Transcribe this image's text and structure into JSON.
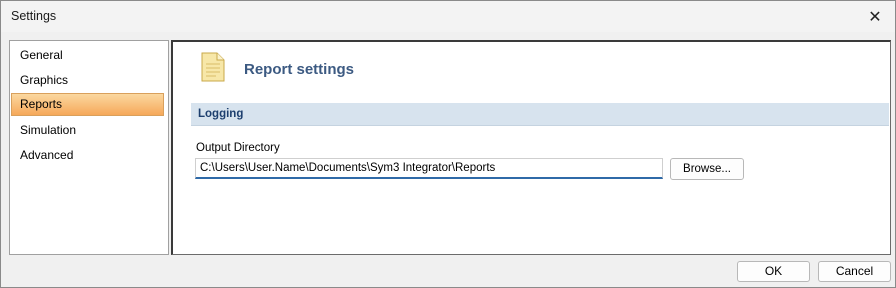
{
  "window": {
    "title": "Settings",
    "close_glyph": "✕"
  },
  "sidebar": {
    "items": [
      {
        "label": "General"
      },
      {
        "label": "Graphics"
      },
      {
        "label": "Reports"
      },
      {
        "label": "Simulation"
      },
      {
        "label": "Advanced"
      }
    ],
    "selected_index": 2
  },
  "main": {
    "icon": "document-icon",
    "title": "Report settings",
    "section": {
      "title": "Logging"
    },
    "output_directory": {
      "label": "Output Directory",
      "value": "C:\\Users\\User.Name\\Documents\\Sym3 Integrator\\Reports",
      "browse_label": "Browse..."
    }
  },
  "footer": {
    "ok_label": "OK",
    "cancel_label": "Cancel"
  },
  "colors": {
    "selection_top": "#fbd8a0",
    "selection_bottom": "#f6a85a",
    "section_bar": "#d7e3ee",
    "title_text": "#3c5a82",
    "input_focus": "#2f6aa8"
  }
}
